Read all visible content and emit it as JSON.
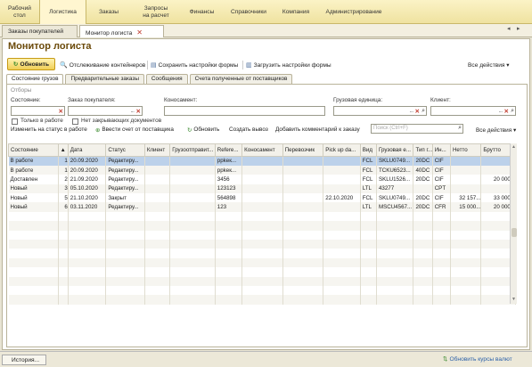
{
  "topnav": [
    {
      "label": "Рабочий\nстол"
    },
    {
      "label": "Логистика"
    },
    {
      "label": "Заказы"
    },
    {
      "label": "Запросы\nна расчет"
    },
    {
      "label": "Финансы"
    },
    {
      "label": "Справочники"
    },
    {
      "label": "Компания"
    },
    {
      "label": "Администрирование"
    }
  ],
  "window_tabs": [
    {
      "label": "Заказы покупателей"
    },
    {
      "label": "Монитор логиста"
    }
  ],
  "page": {
    "title": "Монитор логиста"
  },
  "toolbar": {
    "refresh": "Обновить",
    "track": "Отслеживание контейнеров",
    "save": "Сохранить настройки формы",
    "load": "Загрузить настройки формы",
    "all_actions": "Все действия ▾"
  },
  "subtabs": [
    "Состояние грузов",
    "Предварительные заказы",
    "Сообщения",
    "Счета полученные от поставщиков"
  ],
  "filters": {
    "group": "Отборы",
    "state": "Состояние:",
    "buyer_order": "Заказ покупателя:",
    "consignment": "Коносамент:",
    "cargo_unit": "Грузовая единица:",
    "client": "Клиент:",
    "in_work": "Только в работе",
    "no_closing": "Нет закрывающих документов"
  },
  "table_toolbar": {
    "change_status": "Изменить на статус в работе",
    "enter_invoice": "Ввести счет от поставщика",
    "refresh": "Обновить",
    "create_export": "Создать вывоз",
    "add_comment": "Добавить комментарий к заказу",
    "search_placeholder": "Поиск (Ctrl+F)",
    "all_actions": "Все действия ▾"
  },
  "table": {
    "columns": [
      "Состояние",
      "",
      "Дата",
      "Статус",
      "Клиент",
      "Грузоотправит...",
      "Refere...",
      "Коносамент",
      "Перевозчик",
      "Pick up da...",
      "Вид",
      "Грузовая е...",
      "Тип г...",
      "Ин...",
      "Нетто",
      "Брутто"
    ],
    "sort_icon": "sort-up-icon",
    "rows": [
      [
        "В работе",
        "1",
        "20.09.2020",
        "Редактиру...",
        "",
        "",
        "ррkек...",
        "",
        "",
        "",
        "FCL",
        "SKLU0749...",
        "20DC",
        "CIF",
        "",
        ""
      ],
      [
        "В работе",
        "1",
        "20.09.2020",
        "Редактиру...",
        "",
        "",
        "ррkек...",
        "",
        "",
        "",
        "FCL",
        "TCKU6523...",
        "40DC",
        "CIF",
        "",
        ""
      ],
      [
        "Доставлен",
        "2",
        "21.09.2020",
        "Редактиру...",
        "",
        "",
        "3456",
        "",
        "",
        "",
        "FCL",
        "SKLU1526...",
        "20DC",
        "CIF",
        "",
        "20 000..."
      ],
      [
        "Новый",
        "3",
        "05.10.2020",
        "Редактиру...",
        "",
        "",
        "123123",
        "",
        "",
        "",
        "LTL",
        "43277",
        "",
        "CPT",
        "",
        ""
      ],
      [
        "Новый",
        "5",
        "21.10.2020",
        "Закрыт",
        "",
        "",
        "564898",
        "",
        "",
        "22.10.2020",
        "FCL",
        "SKLU0749...",
        "20DC",
        "CIF",
        "32 157...",
        "33 000..."
      ],
      [
        "Новый",
        "6",
        "03.11.2020",
        "Редактиру...",
        "",
        "",
        "123",
        "",
        "",
        "",
        "LTL",
        "MSCU4567...",
        "20DC",
        "CFR",
        "15 000...",
        "20 000..."
      ]
    ]
  },
  "statusbar": {
    "history": "История...",
    "currency": "Обновить курсы валют"
  }
}
